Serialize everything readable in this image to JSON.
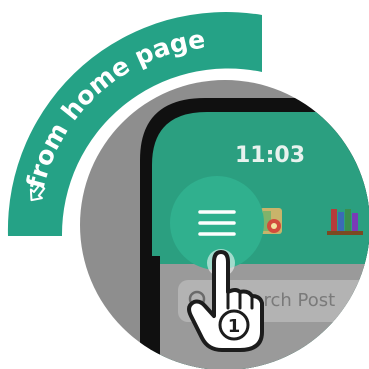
{
  "callout": {
    "text": "from home page",
    "arrow_icon": "left-arrow-icon",
    "color": "#25a286"
  },
  "phone": {
    "status_time": "11:03",
    "header_color": "#2b9f80",
    "menu_button": {
      "icon": "hamburger-menu-icon",
      "highlight_color": "#30b08e"
    },
    "header_icons": [
      "map-pin-icon",
      "books-icon"
    ],
    "search": {
      "placeholder": "Search Post",
      "icon": "search-icon"
    }
  },
  "step": {
    "number": "1",
    "gesture_icon": "pointing-hand-icon"
  }
}
